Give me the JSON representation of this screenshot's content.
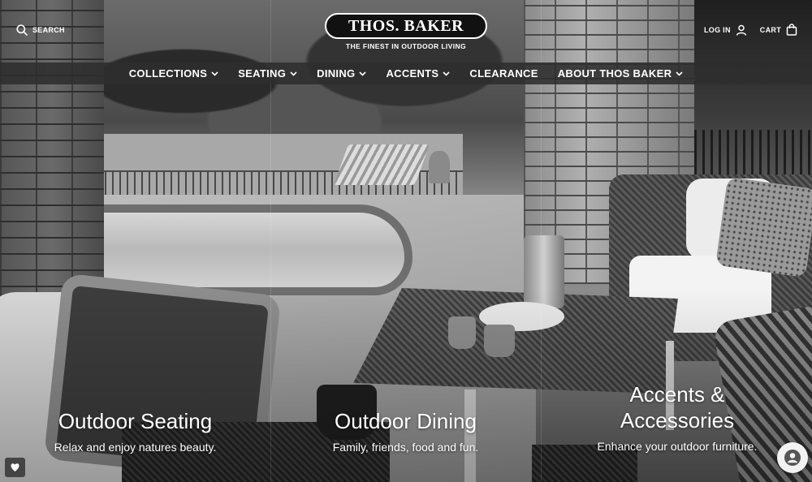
{
  "header": {
    "search_label": "SEARCH",
    "logo_text": "THOS. BAKER",
    "tagline": "THE FINEST IN OUTDOOR LIVING",
    "login_label": "LOG IN",
    "cart_label": "CART"
  },
  "nav": {
    "items": [
      {
        "label": "COLLECTIONS",
        "has_dropdown": true
      },
      {
        "label": "SEATING",
        "has_dropdown": true
      },
      {
        "label": "DINING",
        "has_dropdown": true
      },
      {
        "label": "ACCENTS",
        "has_dropdown": true
      },
      {
        "label": "CLEARANCE",
        "has_dropdown": false
      },
      {
        "label": "ABOUT THOS BAKER",
        "has_dropdown": true
      }
    ]
  },
  "hero": {
    "panels": [
      {
        "title": "Outdoor Seating",
        "subtitle": "Relax and enjoy natures beauty."
      },
      {
        "title": "Outdoor Dining",
        "subtitle": "Family, friends, food and fun."
      },
      {
        "title_line1": "Accents &",
        "title_line2": "Accessories",
        "subtitle": "Enhance your outdoor furniture."
      }
    ]
  },
  "widgets": {
    "wishlist_icon": "heart-icon",
    "chat_icon": "user-icon"
  },
  "colors": {
    "navbar": "#2d2d2d",
    "text": "#ffffff",
    "logo_bg": "#111111"
  }
}
